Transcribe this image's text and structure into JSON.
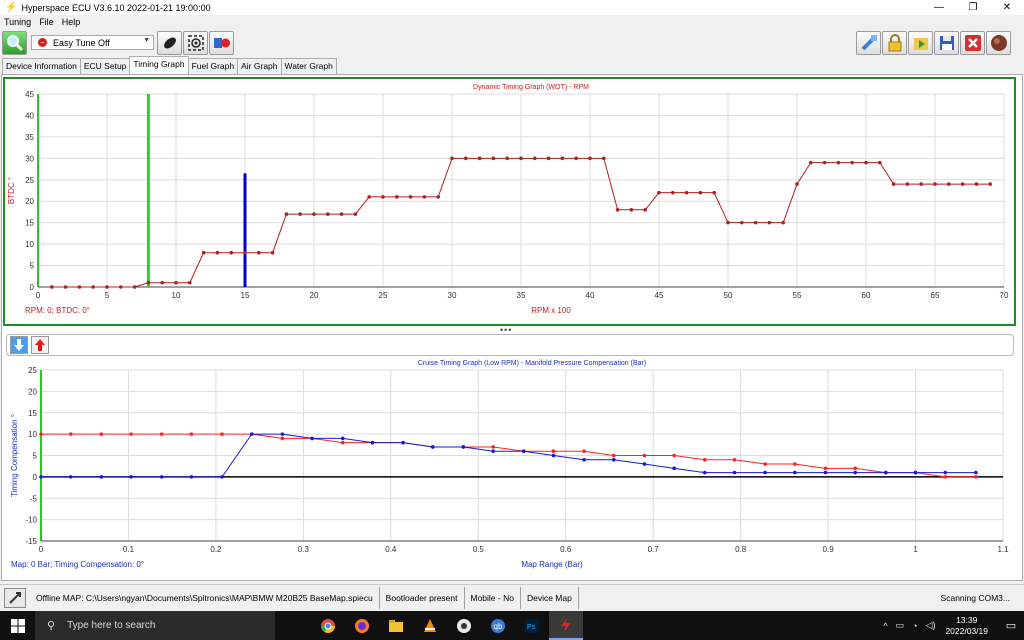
{
  "window": {
    "title": "Hyperspace ECU V3.6.10 2022-01-21 19:00:00",
    "controls": [
      "—",
      "❐",
      "✕"
    ]
  },
  "menu": [
    "Tuning",
    "File",
    "Help"
  ],
  "toolbar": {
    "easy_tune": "Easy Tune Off",
    "right_icons": [
      "connect-icon",
      "lock-icon",
      "open-map-icon",
      "save-icon",
      "close-map-icon",
      "power-icon"
    ]
  },
  "tabs": [
    "Device Information",
    "ECU Setup",
    "Timing Graph",
    "Fuel Graph",
    "Air Graph",
    "Water Graph"
  ],
  "active_tab": "Timing Graph",
  "grip": "•••",
  "chart_data": [
    {
      "type": "line",
      "title": "Dynamic Timing Graph (WOT) - RPM",
      "xlabel": "RPM x 100",
      "ylabel": "BTDC °",
      "readout": "RPM: 0; BTDC: 0°",
      "xlim": [
        0,
        70
      ],
      "ylim": [
        0,
        45
      ],
      "xticks": [
        0,
        5,
        10,
        15,
        20,
        25,
        30,
        35,
        40,
        45,
        50,
        55,
        60,
        65,
        70
      ],
      "yticks": [
        0,
        5,
        10,
        15,
        20,
        25,
        30,
        35,
        40,
        45
      ],
      "markers": [
        {
          "x": 8,
          "top": 45,
          "color": "#33cc33"
        },
        {
          "x": 15,
          "top": 26.5,
          "color": "#0000cc"
        }
      ],
      "series": [
        {
          "color": "#b02020",
          "x": [
            1,
            2,
            3,
            4,
            5,
            6,
            7,
            8,
            9,
            10,
            11,
            12,
            13,
            14,
            15,
            16,
            17,
            18,
            19,
            20,
            21,
            22,
            23,
            24,
            25,
            26,
            27,
            28,
            29,
            30,
            31,
            32,
            33,
            34,
            35,
            36,
            37,
            38,
            39,
            40,
            41,
            42,
            43,
            44,
            45,
            46,
            47,
            48,
            49,
            50,
            51,
            52,
            53,
            54,
            55,
            56,
            57,
            58,
            59,
            60,
            61,
            62,
            63,
            64,
            65,
            66,
            67,
            68,
            69
          ],
          "y": [
            0,
            0,
            0,
            0,
            0,
            0,
            0,
            1,
            1,
            1,
            1,
            8,
            8,
            8,
            8,
            8,
            8,
            17,
            17,
            17,
            17,
            17,
            17,
            21,
            21,
            21,
            21,
            21,
            21,
            30,
            30,
            30,
            30,
            30,
            30,
            30,
            30,
            30,
            30,
            30,
            30,
            18,
            18,
            18,
            22,
            22,
            22,
            22,
            22,
            15,
            15,
            15,
            15,
            15,
            24,
            29,
            29,
            29,
            29,
            29,
            29,
            24,
            24,
            24,
            24,
            24,
            24,
            24,
            24
          ]
        }
      ]
    },
    {
      "type": "line",
      "title": "Cruise Timing Graph (Low RPM) - Manifold Pressure Compensation (Bar)",
      "xlabel": "Map Range (Bar)",
      "ylabel": "Timing Compensation °",
      "readout": "Map: 0 Bar; Timing Compensation: 0°",
      "xlim": [
        0,
        1.1
      ],
      "ylim": [
        -15,
        25
      ],
      "xticks": [
        0,
        0.1,
        0.2,
        0.3,
        0.4,
        0.5,
        0.6,
        0.7,
        0.8,
        0.9,
        1,
        1.1
      ],
      "yticks": [
        -15,
        -10,
        -5,
        0,
        5,
        10,
        15,
        20,
        25
      ],
      "series": [
        {
          "color": "#ff2020",
          "x": [
            0,
            0.034,
            0.069,
            0.103,
            0.138,
            0.172,
            0.207,
            0.241,
            0.276,
            0.31,
            0.345,
            0.379,
            0.414,
            0.448,
            0.483,
            0.517,
            0.552,
            0.586,
            0.621,
            0.655,
            0.69,
            0.724,
            0.759,
            0.793,
            0.828,
            0.862,
            0.897,
            0.931,
            0.966,
            1,
            1.034,
            1.069
          ],
          "y": [
            10,
            10,
            10,
            10,
            10,
            10,
            10,
            10,
            9,
            9,
            8,
            8,
            8,
            7,
            7,
            7,
            6,
            6,
            6,
            5,
            5,
            5,
            4,
            4,
            3,
            3,
            2,
            2,
            1,
            1,
            0,
            0
          ]
        },
        {
          "color": "#1818d8",
          "x": [
            0,
            0.034,
            0.069,
            0.103,
            0.138,
            0.172,
            0.207,
            0.241,
            0.276,
            0.31,
            0.345,
            0.379,
            0.414,
            0.448,
            0.483,
            0.517,
            0.552,
            0.586,
            0.621,
            0.655,
            0.69,
            0.724,
            0.759,
            0.793,
            0.828,
            0.862,
            0.897,
            0.931,
            0.966,
            1,
            1.034,
            1.069
          ],
          "y": [
            0,
            0,
            0,
            0,
            0,
            0,
            0,
            10,
            10,
            9,
            9,
            8,
            8,
            7,
            7,
            6,
            6,
            5,
            4,
            4,
            3,
            2,
            1,
            1,
            1,
            1,
            1,
            1,
            1,
            1,
            1,
            1
          ]
        }
      ]
    }
  ],
  "status": {
    "map": "Offline MAP: C:\\Users\\ngyan\\Documents\\Spitronics\\MAP\\BMW M20B25 BaseMap.spiecu",
    "bootloader": "Bootloader present",
    "mobile": "Mobile - No",
    "device_map": "Device Map",
    "scanning": "Scanning COM3..."
  },
  "taskbar": {
    "search": "Type here to search",
    "time": "13:39",
    "date": "2022/03/19",
    "apps": [
      "chrome-icon",
      "firefox-icon",
      "file-explorer-icon",
      "vlc-icon",
      "obs-icon",
      "qbittorrent-icon",
      "photoshop-icon",
      "hyperspace-ecu-icon"
    ]
  }
}
